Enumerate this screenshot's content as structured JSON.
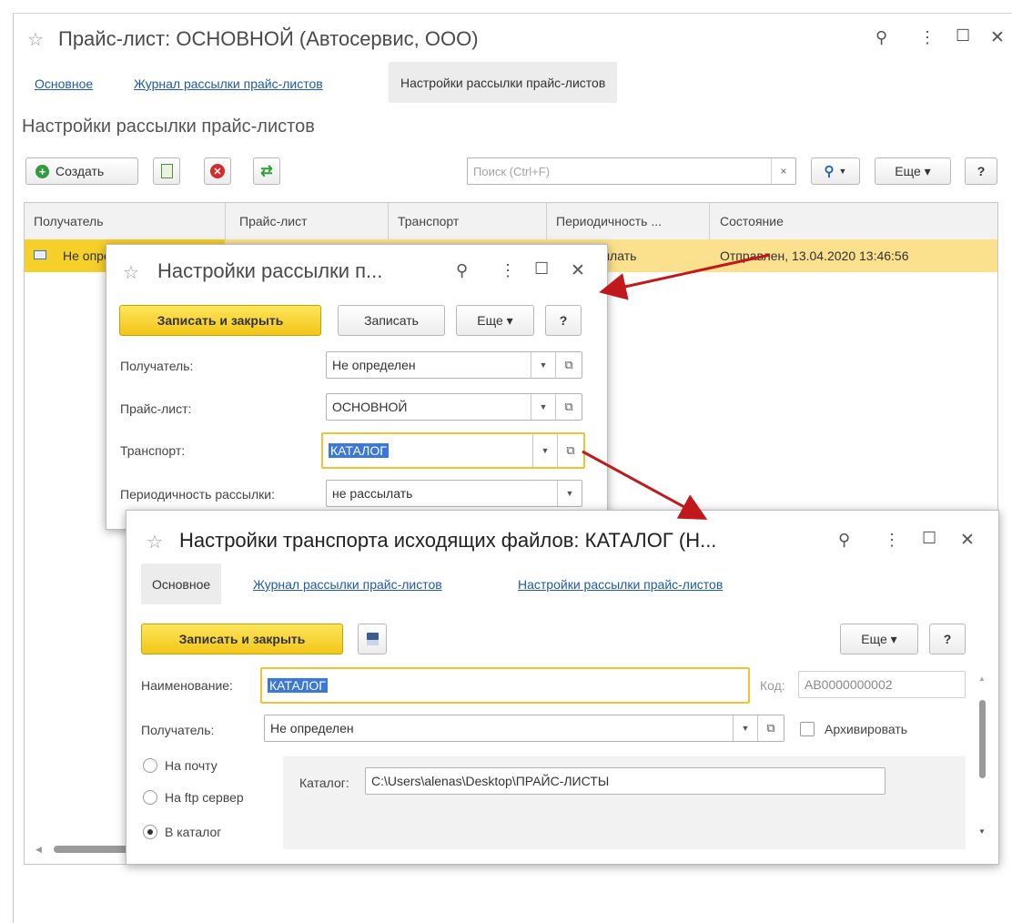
{
  "main": {
    "title": "Прайс-лист: ОСНОВНОЙ (Автосервис, ООО)",
    "tabs": [
      {
        "label": "Основное"
      },
      {
        "label": "Журнал рассылки прайс-листов"
      },
      {
        "label": "Настройки рассылки прайс-листов"
      }
    ],
    "section_title": "Настройки рассылки прайс-листов",
    "toolbar": {
      "create_label": "Создать",
      "search_placeholder": "Поиск (Ctrl+F)",
      "search_clear": "×",
      "more_label": "Еще ▾",
      "help_label": "?"
    },
    "table": {
      "headers": [
        "Получатель",
        "Прайс-лист",
        "Транспорт",
        "Периодичность ...",
        "Состояние"
      ],
      "row": {
        "recipient": "Не определен",
        "periodicity": "не рассылать",
        "state": "Отправлен, 13.04.2020 13:46:56"
      }
    }
  },
  "dialog1": {
    "title": "Настройки рассылки п...",
    "save_close_label": "Записать и закрыть",
    "save_label": "Записать",
    "more_label": "Еще ▾",
    "help_label": "?",
    "fields": {
      "recipient_label": "Получатель:",
      "recipient_value": "Не определен",
      "pricelist_label": "Прайс-лист:",
      "pricelist_value": "ОСНОВНОЙ",
      "transport_label": "Транспорт:",
      "transport_value": "КАТАЛОГ",
      "periodicity_label": "Периодичность рассылки:",
      "periodicity_value": "не рассылать"
    }
  },
  "dialog2": {
    "title": "Настройки транспорта исходящих файлов: КАТАЛОГ (Н...",
    "tabs": [
      {
        "label": "Основное"
      },
      {
        "label": "Журнал рассылки прайс-листов"
      },
      {
        "label": "Настройки рассылки прайс-листов"
      }
    ],
    "save_close_label": "Записать и закрыть",
    "more_label": "Еще ▾",
    "help_label": "?",
    "name_label": "Наименование:",
    "name_value": "КАТАЛОГ",
    "code_label": "Код:",
    "code_value": "АВ0000000002",
    "recipient_label": "Получатель:",
    "recipient_value": "Не определен",
    "archive_label": "Архивировать",
    "radios": [
      {
        "label": "На почту",
        "checked": false
      },
      {
        "label": "На ftp сервер",
        "checked": false
      },
      {
        "label": "В каталог",
        "checked": true
      }
    ],
    "catalog_label": "Каталог:",
    "catalog_value": "C:\\Users\\alenas\\Desktop\\ПРАЙС-ЛИСТЫ"
  },
  "colors": {
    "accent_yellow": "#f5cf2a",
    "link_blue": "#1f5aa8",
    "annotation_arrow": "#c0181b",
    "selected_row": "#fbe08d"
  }
}
